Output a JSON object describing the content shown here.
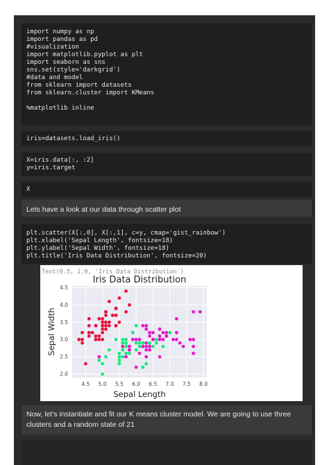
{
  "cells": {
    "imports": [
      "import numpy as np",
      "import pandas as pd",
      "#visualization",
      "import matplotlib.pyplot as plt",
      "import seaborn as sns",
      "sns.set(style='darkgrid')",
      "#data and model",
      "from sklearn import datasets",
      "from sklearn.cluster import KMeans",
      "",
      "%matplotlib inline"
    ],
    "load": "iris=datasets.load_iris()",
    "xy": [
      "X=iris.data[:, :2]",
      "y=iris.target"
    ],
    "x": "X",
    "scatter": [
      "plt.scatter(X[:,0], X[:,1], c=y, cmap='gist_rainbow')",
      "plt.xlabel('Sepal Length', fontsize=18)",
      "plt.ylabel('Sepal Width', fontsize=18)",
      "plt.title('Iris Data Distribution', fontsize=20)"
    ]
  },
  "markdown": {
    "scatter_intro": "Lets have a look at our data through scatter plot",
    "kmeans_intro": "Now, let's instantiate and fit our K means cluster model. We are going to use three clusters and a random state of 21"
  },
  "output_text": "Text(0.5, 1.0, 'Iris Data Distribution')",
  "colors": {
    "class0": "#e8123c",
    "class1": "#18e87a",
    "class2": "#e818c8",
    "plot_bg": "#eaeaf2"
  },
  "chart_data": {
    "type": "scatter",
    "title": "Iris Data Distribution",
    "xlabel": "Sepal Length",
    "ylabel": "Sepal Width",
    "xlim": [
      4.1,
      8.1
    ],
    "ylim": [
      1.9,
      4.55
    ],
    "xticks": [
      "4.5",
      "5.0",
      "5.5",
      "6.0",
      "6.5",
      "7.0",
      "7.5",
      "8.0"
    ],
    "yticks": [
      "2.0",
      "2.5",
      "3.0",
      "3.5",
      "4.0",
      "4.5"
    ],
    "grid": true,
    "series": [
      {
        "values": [
          [
            5.1,
            3.5
          ],
          [
            4.9,
            3.0
          ],
          [
            4.7,
            3.2
          ],
          [
            4.6,
            3.1
          ],
          [
            5.0,
            3.6
          ],
          [
            5.4,
            3.9
          ],
          [
            4.6,
            3.4
          ],
          [
            5.0,
            3.4
          ],
          [
            4.4,
            2.9
          ],
          [
            4.9,
            3.1
          ],
          [
            5.4,
            3.7
          ],
          [
            4.8,
            3.4
          ],
          [
            4.8,
            3.0
          ],
          [
            4.3,
            3.0
          ],
          [
            5.8,
            4.0
          ],
          [
            5.7,
            4.4
          ],
          [
            5.4,
            3.9
          ],
          [
            5.1,
            3.5
          ],
          [
            5.7,
            3.8
          ],
          [
            5.1,
            3.8
          ],
          [
            5.4,
            3.4
          ],
          [
            5.1,
            3.7
          ],
          [
            4.6,
            3.6
          ],
          [
            5.1,
            3.3
          ],
          [
            4.8,
            3.4
          ],
          [
            5.0,
            3.0
          ],
          [
            5.0,
            3.4
          ],
          [
            5.2,
            3.5
          ],
          [
            5.2,
            3.4
          ],
          [
            4.7,
            3.2
          ],
          [
            4.8,
            3.1
          ],
          [
            5.4,
            3.4
          ],
          [
            5.2,
            4.1
          ],
          [
            5.5,
            4.2
          ],
          [
            4.9,
            3.1
          ],
          [
            5.0,
            3.2
          ],
          [
            5.5,
            3.5
          ],
          [
            4.9,
            3.6
          ],
          [
            4.4,
            3.0
          ],
          [
            5.1,
            3.4
          ],
          [
            5.0,
            3.5
          ],
          [
            4.5,
            2.3
          ],
          [
            4.4,
            3.2
          ],
          [
            5.0,
            3.5
          ],
          [
            5.1,
            3.8
          ],
          [
            4.8,
            3.0
          ],
          [
            5.1,
            3.8
          ],
          [
            4.6,
            3.2
          ],
          [
            5.3,
            3.7
          ],
          [
            5.0,
            3.3
          ]
        ]
      },
      {
        "values": [
          [
            7.0,
            3.2
          ],
          [
            6.4,
            3.2
          ],
          [
            6.9,
            3.1
          ],
          [
            5.5,
            2.3
          ],
          [
            6.5,
            2.8
          ],
          [
            5.7,
            2.8
          ],
          [
            6.3,
            3.3
          ],
          [
            4.9,
            2.4
          ],
          [
            6.6,
            2.9
          ],
          [
            5.2,
            2.7
          ],
          [
            5.0,
            2.0
          ],
          [
            5.9,
            3.0
          ],
          [
            6.0,
            2.2
          ],
          [
            6.1,
            2.9
          ],
          [
            5.6,
            2.9
          ],
          [
            6.7,
            3.1
          ],
          [
            5.6,
            3.0
          ],
          [
            5.8,
            2.7
          ],
          [
            6.2,
            2.2
          ],
          [
            5.6,
            2.5
          ],
          [
            5.9,
            3.2
          ],
          [
            6.1,
            2.8
          ],
          [
            6.3,
            2.5
          ],
          [
            6.1,
            2.8
          ],
          [
            6.4,
            2.9
          ],
          [
            6.6,
            3.0
          ],
          [
            6.8,
            2.8
          ],
          [
            6.7,
            3.0
          ],
          [
            6.0,
            2.9
          ],
          [
            5.7,
            2.6
          ],
          [
            5.5,
            2.4
          ],
          [
            5.5,
            2.4
          ],
          [
            5.8,
            2.7
          ],
          [
            6.0,
            2.7
          ],
          [
            5.4,
            3.0
          ],
          [
            6.0,
            3.4
          ],
          [
            6.7,
            3.1
          ],
          [
            6.3,
            2.3
          ],
          [
            5.6,
            3.0
          ],
          [
            5.5,
            2.5
          ],
          [
            5.5,
            2.6
          ],
          [
            6.1,
            3.0
          ],
          [
            5.8,
            2.6
          ],
          [
            5.0,
            2.3
          ],
          [
            5.6,
            2.7
          ],
          [
            5.7,
            3.0
          ],
          [
            5.7,
            2.9
          ],
          [
            6.2,
            2.9
          ],
          [
            5.1,
            2.5
          ],
          [
            5.7,
            2.8
          ]
        ]
      },
      {
        "values": [
          [
            6.3,
            3.3
          ],
          [
            5.8,
            2.7
          ],
          [
            7.1,
            3.0
          ],
          [
            6.3,
            2.9
          ],
          [
            6.5,
            3.0
          ],
          [
            7.6,
            3.0
          ],
          [
            4.9,
            2.5
          ],
          [
            7.3,
            2.9
          ],
          [
            6.7,
            2.5
          ],
          [
            7.2,
            3.6
          ],
          [
            6.5,
            3.2
          ],
          [
            6.4,
            2.7
          ],
          [
            6.8,
            3.0
          ],
          [
            5.7,
            2.5
          ],
          [
            5.8,
            2.8
          ],
          [
            6.4,
            3.2
          ],
          [
            6.5,
            3.0
          ],
          [
            7.7,
            3.8
          ],
          [
            7.7,
            2.6
          ],
          [
            6.0,
            2.2
          ],
          [
            6.9,
            3.2
          ],
          [
            5.6,
            2.8
          ],
          [
            7.7,
            2.8
          ],
          [
            6.3,
            2.7
          ],
          [
            6.7,
            3.3
          ],
          [
            7.2,
            3.2
          ],
          [
            6.2,
            2.8
          ],
          [
            6.1,
            3.0
          ],
          [
            6.4,
            2.8
          ],
          [
            7.2,
            3.0
          ],
          [
            7.4,
            2.8
          ],
          [
            7.9,
            3.8
          ],
          [
            6.4,
            2.8
          ],
          [
            6.3,
            2.8
          ],
          [
            6.1,
            2.6
          ],
          [
            7.7,
            3.0
          ],
          [
            6.3,
            3.4
          ],
          [
            6.4,
            3.1
          ],
          [
            6.0,
            3.0
          ],
          [
            6.9,
            3.1
          ],
          [
            6.7,
            3.1
          ],
          [
            6.9,
            3.1
          ],
          [
            5.8,
            2.7
          ],
          [
            6.8,
            3.2
          ],
          [
            6.7,
            3.3
          ],
          [
            6.7,
            3.0
          ],
          [
            6.3,
            2.5
          ],
          [
            6.5,
            3.0
          ],
          [
            6.2,
            3.4
          ],
          [
            5.9,
            3.0
          ]
        ]
      }
    ]
  }
}
